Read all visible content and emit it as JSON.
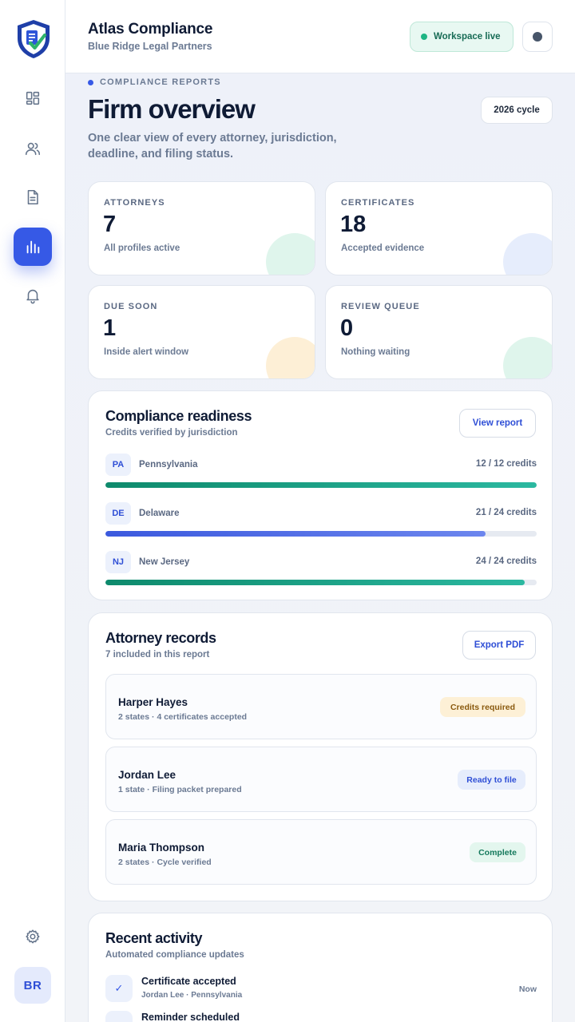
{
  "header": {
    "app_title": "Atlas Compliance",
    "org_name": "Blue Ridge Legal Partners",
    "status_label": "Workspace live"
  },
  "sidebar": {
    "items": [
      {
        "name": "dashboard",
        "icon": "dashboard-icon",
        "active": false
      },
      {
        "name": "attorneys",
        "icon": "users-icon",
        "active": false
      },
      {
        "name": "documents",
        "icon": "document-icon",
        "active": false
      },
      {
        "name": "reports",
        "icon": "bar-chart-icon",
        "active": true
      },
      {
        "name": "alerts",
        "icon": "bell-icon",
        "active": false
      }
    ],
    "settings_icon": "gear-icon",
    "avatar_initials": "BR"
  },
  "page": {
    "eyebrow": "COMPLIANCE REPORTS",
    "title": "Firm overview",
    "cycle": "2026 cycle",
    "subtitle": "One clear view of every attorney, jurisdiction, deadline, and filing status."
  },
  "stats": [
    {
      "label": "ATTORNEYS",
      "value": "7",
      "note": "All profiles active",
      "accent": "#dff5ec"
    },
    {
      "label": "CERTIFICATES",
      "value": "18",
      "note": "Accepted evidence",
      "accent": "#e6edfc"
    },
    {
      "label": "DUE SOON",
      "value": "1",
      "note": "Inside alert window",
      "accent": "#fdefd6"
    },
    {
      "label": "REVIEW QUEUE",
      "value": "0",
      "note": "Nothing waiting",
      "accent": "#dff5ec"
    }
  ],
  "readiness": {
    "title": "Compliance readiness",
    "subtitle": "Credits verified by jurisdiction",
    "button": "View report",
    "rows": [
      {
        "code": "PA",
        "name": "Pennsylvania",
        "credits": "12 / 12 credits",
        "progress": 1.0,
        "color": "green"
      },
      {
        "code": "DE",
        "name": "Delaware",
        "credits": "21 / 24 credits",
        "progress": 0.881,
        "color": "blue"
      },
      {
        "code": "NJ",
        "name": "New Jersey",
        "credits": "24 / 24 credits",
        "progress": 0.972,
        "color": "green"
      }
    ]
  },
  "records": {
    "title": "Attorney records",
    "subtitle": "7 included in this report",
    "button": "Export PDF",
    "rows": [
      {
        "name": "Harper Hayes",
        "detail": "2 states · 4 certificates accepted",
        "badge": "Credits required",
        "badge_type": "warn"
      },
      {
        "name": "Jordan Lee",
        "detail": "1 state · Filing packet prepared",
        "badge": "Ready to file",
        "badge_type": "info"
      },
      {
        "name": "Maria Thompson",
        "detail": "2 states · Cycle verified",
        "badge": "Complete",
        "badge_type": "ok"
      }
    ]
  },
  "activity": {
    "title": "Recent activity",
    "subtitle": "Automated compliance updates",
    "rows": [
      {
        "icon": "check-icon",
        "glyph": "✓",
        "title": "Certificate accepted",
        "detail": "Jordan Lee · Pennsylvania",
        "time": "Now"
      },
      {
        "icon": "clock-icon",
        "glyph": "",
        "title": "Reminder scheduled",
        "detail": "",
        "time": ""
      }
    ]
  }
}
